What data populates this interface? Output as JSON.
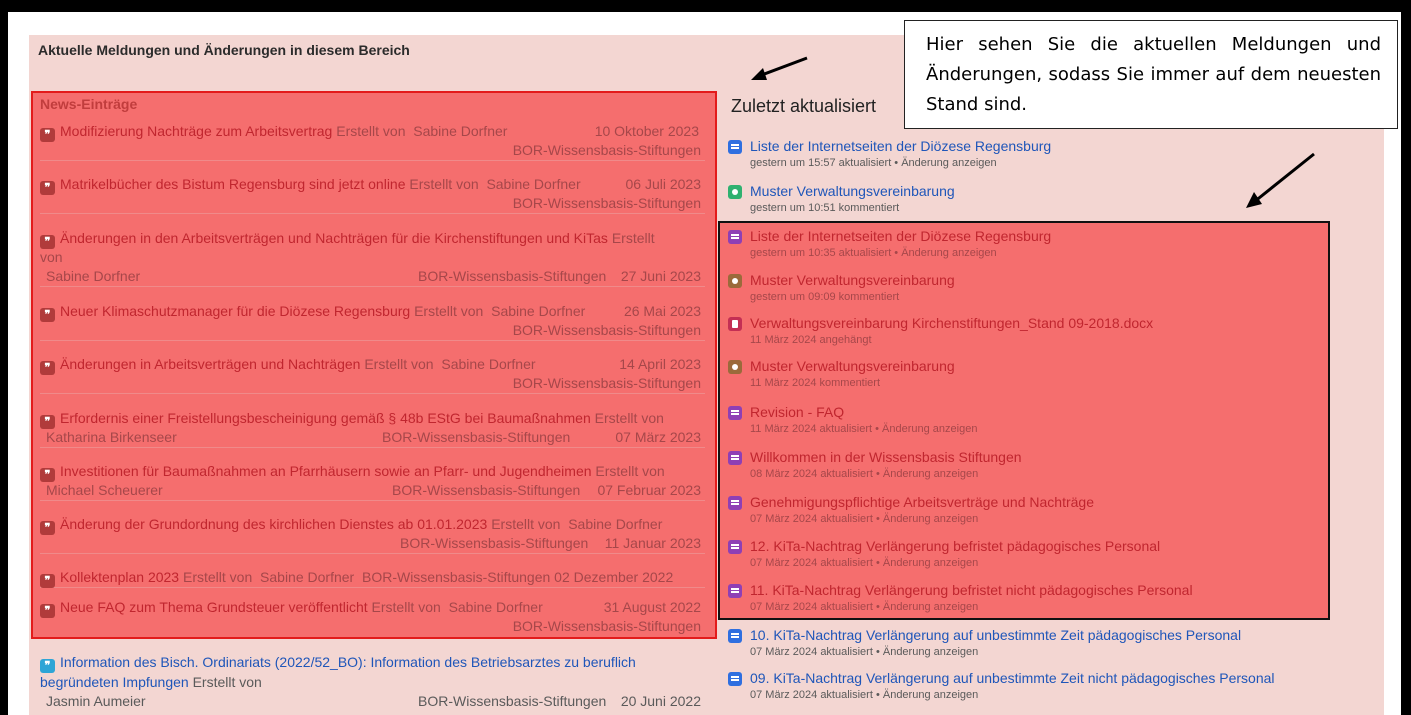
{
  "page": {
    "section_title": "Aktuelle Meldungen und Änderungen in diesem Bereich",
    "callout": "Hier sehen Sie die aktuellen Meldungen und Änderungen, sodass Sie immer auf dem neuesten Stand sind."
  },
  "news": {
    "heading": "News-Einträge",
    "by_label": "Erstellt von",
    "items": [
      {
        "title": "Modifizierung Nachträge zum Arbeitsvertrag",
        "author": "Sabine Dorfner",
        "space": "BOR-Wissensbasis-Stiftungen",
        "date": "10 Oktober 2023"
      },
      {
        "title": "Matrikelbücher des Bistum Regensburg sind jetzt online",
        "author": "Sabine Dorfner",
        "space": "BOR-Wissensbasis-Stiftungen",
        "date": "06 Juli 2023"
      },
      {
        "title": "Änderungen in den Arbeitsverträgen und Nachträgen für die Kirchenstiftungen und KiTas",
        "by_line": "Erstellt",
        "by_line2": "von",
        "author": "Sabine Dorfner",
        "space": "BOR-Wissensbasis-Stiftungen",
        "date": "27 Juni 2023"
      },
      {
        "title": "Neuer Klimaschutzmanager für die Diözese Regensburg",
        "author": "Sabine Dorfner",
        "space": "BOR-Wissensbasis-Stiftungen",
        "date": "26 Mai 2023"
      },
      {
        "title": "Änderungen in Arbeitsverträgen und Nachträgen",
        "author": "Sabine Dorfner",
        "space": "BOR-Wissensbasis-Stiftungen",
        "date": "14 April 2023"
      },
      {
        "title": "Erfordernis einer Freistellungsbescheinigung gemäß § 48b EStG bei Baumaßnahmen",
        "author": "Katharina Birkenseer",
        "space": "BOR-Wissensbasis-Stiftungen",
        "date": "07 März 2023"
      },
      {
        "title": "Investitionen für Baumaßnahmen an Pfarrhäusern sowie an Pfarr- und Jugendheimen",
        "author": "Michael Scheuerer",
        "space": "BOR-Wissensbasis-Stiftungen",
        "date": "07 Februar 2023"
      },
      {
        "title": "Änderung der Grundordnung des kirchlichen Dienstes ab 01.01.2023",
        "author": "Sabine Dorfner",
        "space": "BOR-Wissensbasis-Stiftungen",
        "date": "11 Januar 2023"
      },
      {
        "title": "Kollektenplan 2023",
        "author": "Sabine Dorfner",
        "space": "BOR-Wissensbasis-Stiftungen",
        "date": "02 Dezember 2022"
      },
      {
        "title": "Neue FAQ zum Thema Grundsteuer veröffentlicht",
        "author": "Sabine Dorfner",
        "space": "BOR-Wissensbasis-Stiftungen",
        "date": "31 August 2022"
      }
    ],
    "extra": {
      "title_line1": "Information des Bisch. Ordinariats (2022/52_BO): Information des Betriebsarztes zu beruflich",
      "title_line2": "begründeten Impfungen",
      "by": "Erstellt von",
      "author": "Jasmin Aumeier",
      "space": "BOR-Wissensbasis-Stiftungen",
      "date": "20 Juni 2022"
    }
  },
  "recent": {
    "heading": "Zuletzt aktualisiert",
    "items": [
      {
        "title": "Liste der Internetseiten der Diözese Regensburg",
        "sub": "gestern um 15:57 aktualisiert • Änderung anzeigen",
        "icon": "page-icon",
        "color": "#2f6fe0"
      },
      {
        "title": "Muster Verwaltungsvereinbarung",
        "sub": "gestern um 10:51 kommentiert",
        "icon": "comment-icon",
        "color": "#2fb170"
      },
      {
        "title": "Liste der Internetseiten der Diözese Regensburg",
        "sub": "gestern um 10:35 aktualisiert • Änderung anzeigen",
        "icon": "page-icon",
        "color": "#8f3fb5"
      },
      {
        "title": "Muster Verwaltungsvereinbarung",
        "sub": "gestern um 09:09 kommentiert",
        "icon": "comment-icon",
        "color": "#9b6a3b"
      },
      {
        "title": "Verwaltungsvereinbarung Kirchenstiftungen_Stand 09-2018.docx",
        "sub": "11 März 2024 angehängt",
        "icon": "file-icon",
        "color": "#c42f54"
      },
      {
        "title": "Muster Verwaltungsvereinbarung",
        "sub": "11 März 2024 kommentiert",
        "icon": "comment-icon",
        "color": "#9b6a3b"
      },
      {
        "title": "Revision - FAQ",
        "sub": "11 März 2024 aktualisiert • Änderung anzeigen",
        "icon": "page-icon",
        "color": "#8f3fb5"
      },
      {
        "title": "Willkommen in der Wissensbasis Stiftungen",
        "sub": "08 März 2024 aktualisiert • Änderung anzeigen",
        "icon": "page-icon",
        "color": "#8f3fb5"
      },
      {
        "title": "Genehmigungspflichtige Arbeitsverträge und Nachträge",
        "sub": "07 März 2024 aktualisiert • Änderung anzeigen",
        "icon": "page-icon",
        "color": "#8f3fb5"
      },
      {
        "title": "12. KiTa-Nachtrag Verlängerung befristet pädagogisches Personal",
        "sub": "07 März 2024 aktualisiert • Änderung anzeigen",
        "icon": "page-icon",
        "color": "#8f3fb5"
      },
      {
        "title": "11. KiTa-Nachtrag Verlängerung befristet nicht pädagogisches Personal",
        "sub": "07 März 2024 aktualisiert • Änderung anzeigen",
        "icon": "page-icon",
        "color": "#8f3fb5"
      },
      {
        "title": "10. KiTa-Nachtrag Verlängerung auf unbestimmte Zeit pädagogisches Personal",
        "sub": "07 März 2024 aktualisiert • Änderung anzeigen",
        "icon": "page-icon",
        "color": "#2f6fe0"
      },
      {
        "title": "09. KiTa-Nachtrag Verlängerung auf unbestimmte Zeit nicht pädagogisches Personal",
        "sub": "07 März 2024 aktualisiert • Änderung anzeigen",
        "icon": "page-icon",
        "color": "#2f6fe0"
      }
    ]
  }
}
